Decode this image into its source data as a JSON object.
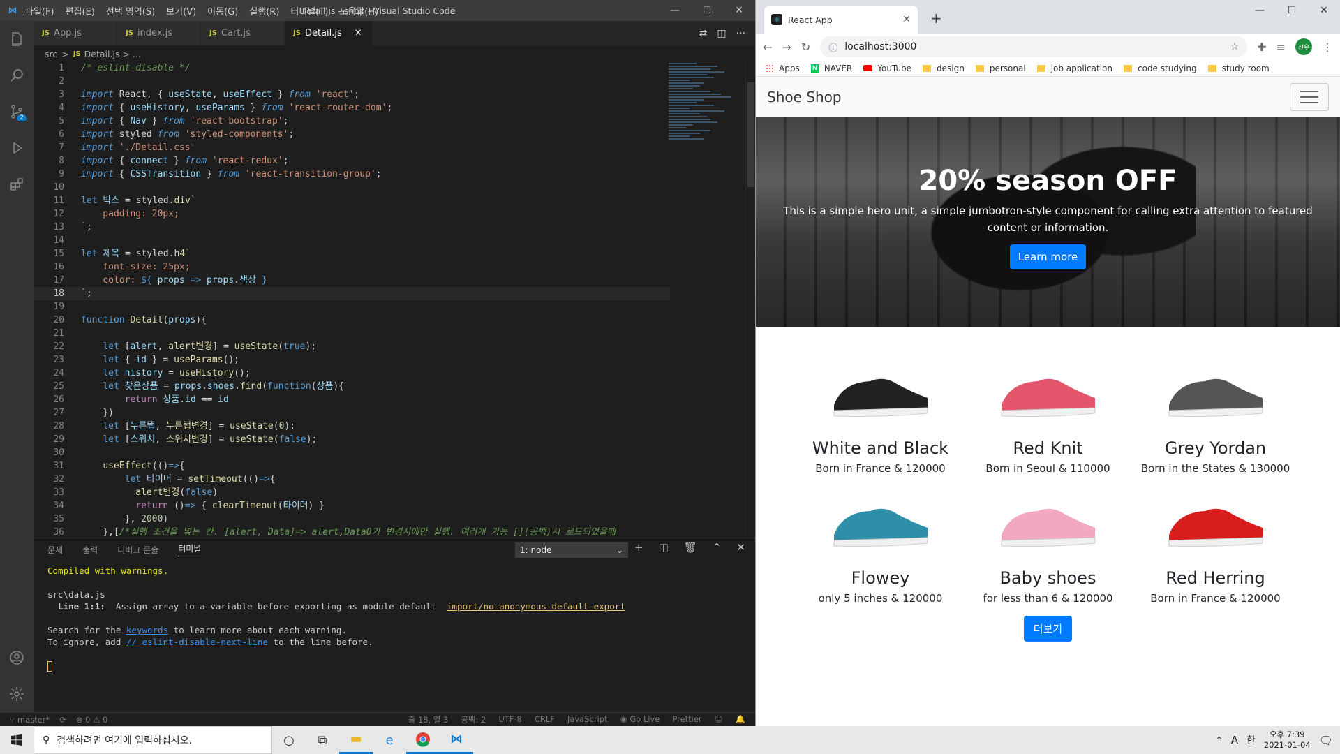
{
  "vscode": {
    "menu": [
      "파일(F)",
      "편집(E)",
      "선택 영역(S)",
      "보기(V)",
      "이동(G)",
      "실행(R)",
      "터미널(T)",
      "도움말(H)"
    ],
    "window_title": "Detail.js - shop - Visual Studio Code",
    "tabs": [
      {
        "label": "App.js",
        "active": false
      },
      {
        "label": "index.js",
        "active": false
      },
      {
        "label": "Cart.js",
        "active": false
      },
      {
        "label": "Detail.js",
        "active": true
      }
    ],
    "breadcrumb": {
      "folder": "src",
      "sep": ">",
      "file": "Detail.js",
      "tail": "> ..."
    },
    "source_control_badge": "2",
    "panel": {
      "tabs": [
        "문제",
        "출력",
        "디버그 콘솔",
        "터미널"
      ],
      "active_tab": "터미널",
      "terminal_select": "1: node",
      "lines": {
        "compiled": "Compiled with warnings.",
        "file": "src\\data.js",
        "warn_loc": "  Line 1:1:",
        "warn_msg": "  Assign array to a variable before exporting as module default  ",
        "warn_rule": "import/no-anonymous-default-export",
        "search_pre": "Search for the ",
        "search_kw": "keywords",
        "search_post": " to learn more about each warning.",
        "ignore_pre": "To ignore, add ",
        "ignore_kw": "// eslint-disable-next-line",
        "ignore_post": " to the line before."
      }
    },
    "status": {
      "branch": "master*",
      "problems": "⊗ 0 ⚠ 0",
      "position": "줄 18, 열 3",
      "spaces": "공백: 2",
      "encoding": "UTF-8",
      "eol": "CRLF",
      "language": "JavaScript",
      "golive": "Go Live",
      "prettier": "Prettier"
    },
    "current_line": 18
  },
  "browser": {
    "tab_title": "React App",
    "url": "localhost:3000",
    "profile": "진우",
    "bookmarks": [
      "Apps",
      "NAVER",
      "YouTube",
      "design",
      "personal",
      "job application",
      "code studying",
      "study room"
    ],
    "navbar_brand": "Shoe Shop",
    "hero": {
      "title": "20% season OFF",
      "text": "This is a simple hero unit, a simple jumbotron-style component for calling extra attention to featured content or information.",
      "button": "Learn more"
    },
    "products": [
      {
        "title": "White and Black",
        "desc": "Born in France & 120000",
        "color": "#222222"
      },
      {
        "title": "Red Knit",
        "desc": "Born in Seoul & 110000",
        "color": "#e2556b"
      },
      {
        "title": "Grey Yordan",
        "desc": "Born in the States & 130000",
        "color": "#555555"
      },
      {
        "title": "Flowey",
        "desc": "only 5 inches & 120000",
        "color": "#2f8fa8"
      },
      {
        "title": "Baby shoes",
        "desc": "for less than 6 & 120000",
        "color": "#f2a7c3"
      },
      {
        "title": "Red Herring",
        "desc": "Born in France & 120000",
        "color": "#d81d1d"
      }
    ],
    "more_button": "더보기"
  },
  "taskbar": {
    "search_placeholder": "검색하려면 여기에 입력하십시오.",
    "ime": "A",
    "ime2": "한",
    "time": "오후 7:39",
    "date": "2021-01-04"
  },
  "colors": {
    "vscode_bg": "#1e1e1e",
    "accent": "#007bff",
    "vs_blue": "#3c9df2"
  }
}
